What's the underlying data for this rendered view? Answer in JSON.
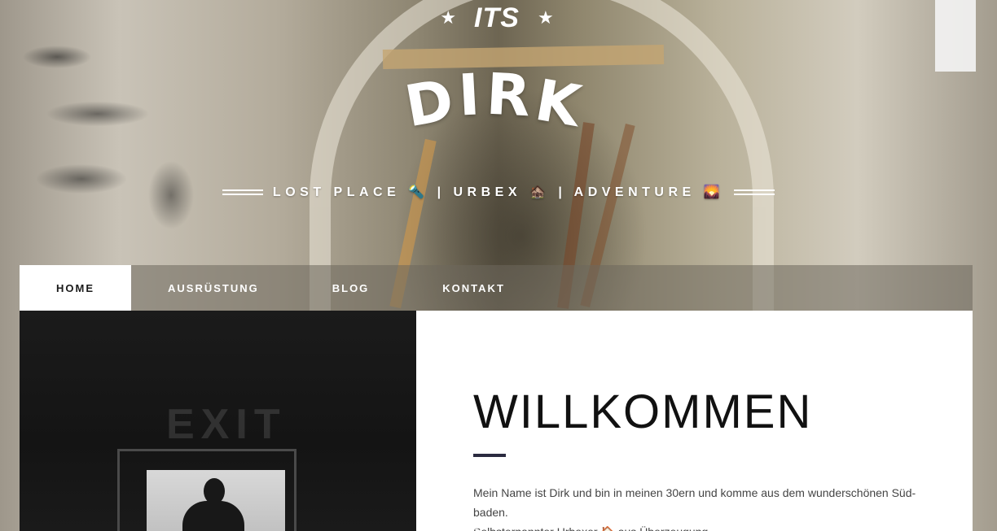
{
  "logo": {
    "top_text": "ITS",
    "main_letters": [
      "D",
      "I",
      "R",
      "K"
    ],
    "star_glyph": "★"
  },
  "tagline": {
    "text": "LOST PLACE 🔦 | URBEX 🏚️ | ADVENTURE 🌄"
  },
  "nav": {
    "items": [
      {
        "label": "HOME",
        "active": true
      },
      {
        "label": "AUSRÜSTUNG",
        "active": false
      },
      {
        "label": "BLOG",
        "active": false
      },
      {
        "label": "KONTAKT",
        "active": false
      }
    ]
  },
  "hero": {
    "sign_text": "EXIT"
  },
  "content": {
    "title": "WILLKOMMEN",
    "intro_line1": "Mein Name ist Dirk und bin in meinen 30ern und komme aus dem wunderschönen Süd-baden.",
    "intro_line2": "Selbsternannter Urbexer 🏠 aus Überzeugung."
  },
  "colors": {
    "accent_rule": "#2b2b40",
    "nav_active_bg": "#ffffff",
    "nav_bar_bg": "rgba(110,104,92,0.55)"
  }
}
